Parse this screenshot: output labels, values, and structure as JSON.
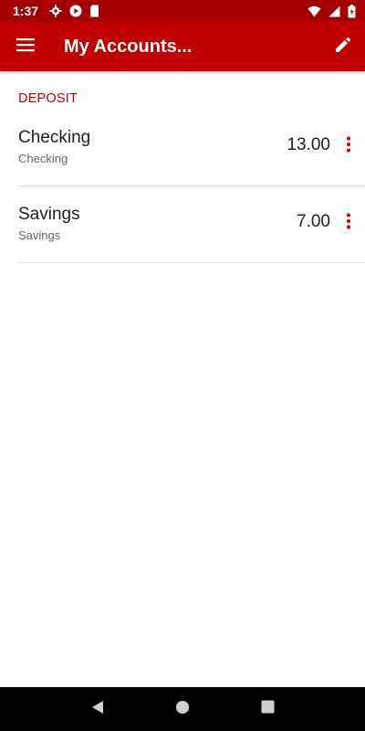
{
  "status_bar": {
    "time": "1:37",
    "icons_left": [
      "settings-icon",
      "play-icon",
      "sd-card-icon"
    ],
    "icons_right": [
      "wifi-icon",
      "signal-icon",
      "battery-icon"
    ]
  },
  "app_bar": {
    "title": "My Accounts...",
    "menu_icon": "hamburger-menu-icon",
    "edit_icon": "pencil-icon"
  },
  "section": {
    "header": "DEPOSIT",
    "accounts": [
      {
        "name": "Checking",
        "type": "Checking",
        "balance": "13.00"
      },
      {
        "name": "Savings",
        "type": "Savings",
        "balance": "7.00"
      }
    ]
  },
  "nav_bar": {
    "icons": [
      "back-icon",
      "home-icon",
      "recents-icon"
    ]
  },
  "colors": {
    "status_bar": "#a50000",
    "app_bar": "#c00000",
    "accent": "#c00000"
  }
}
